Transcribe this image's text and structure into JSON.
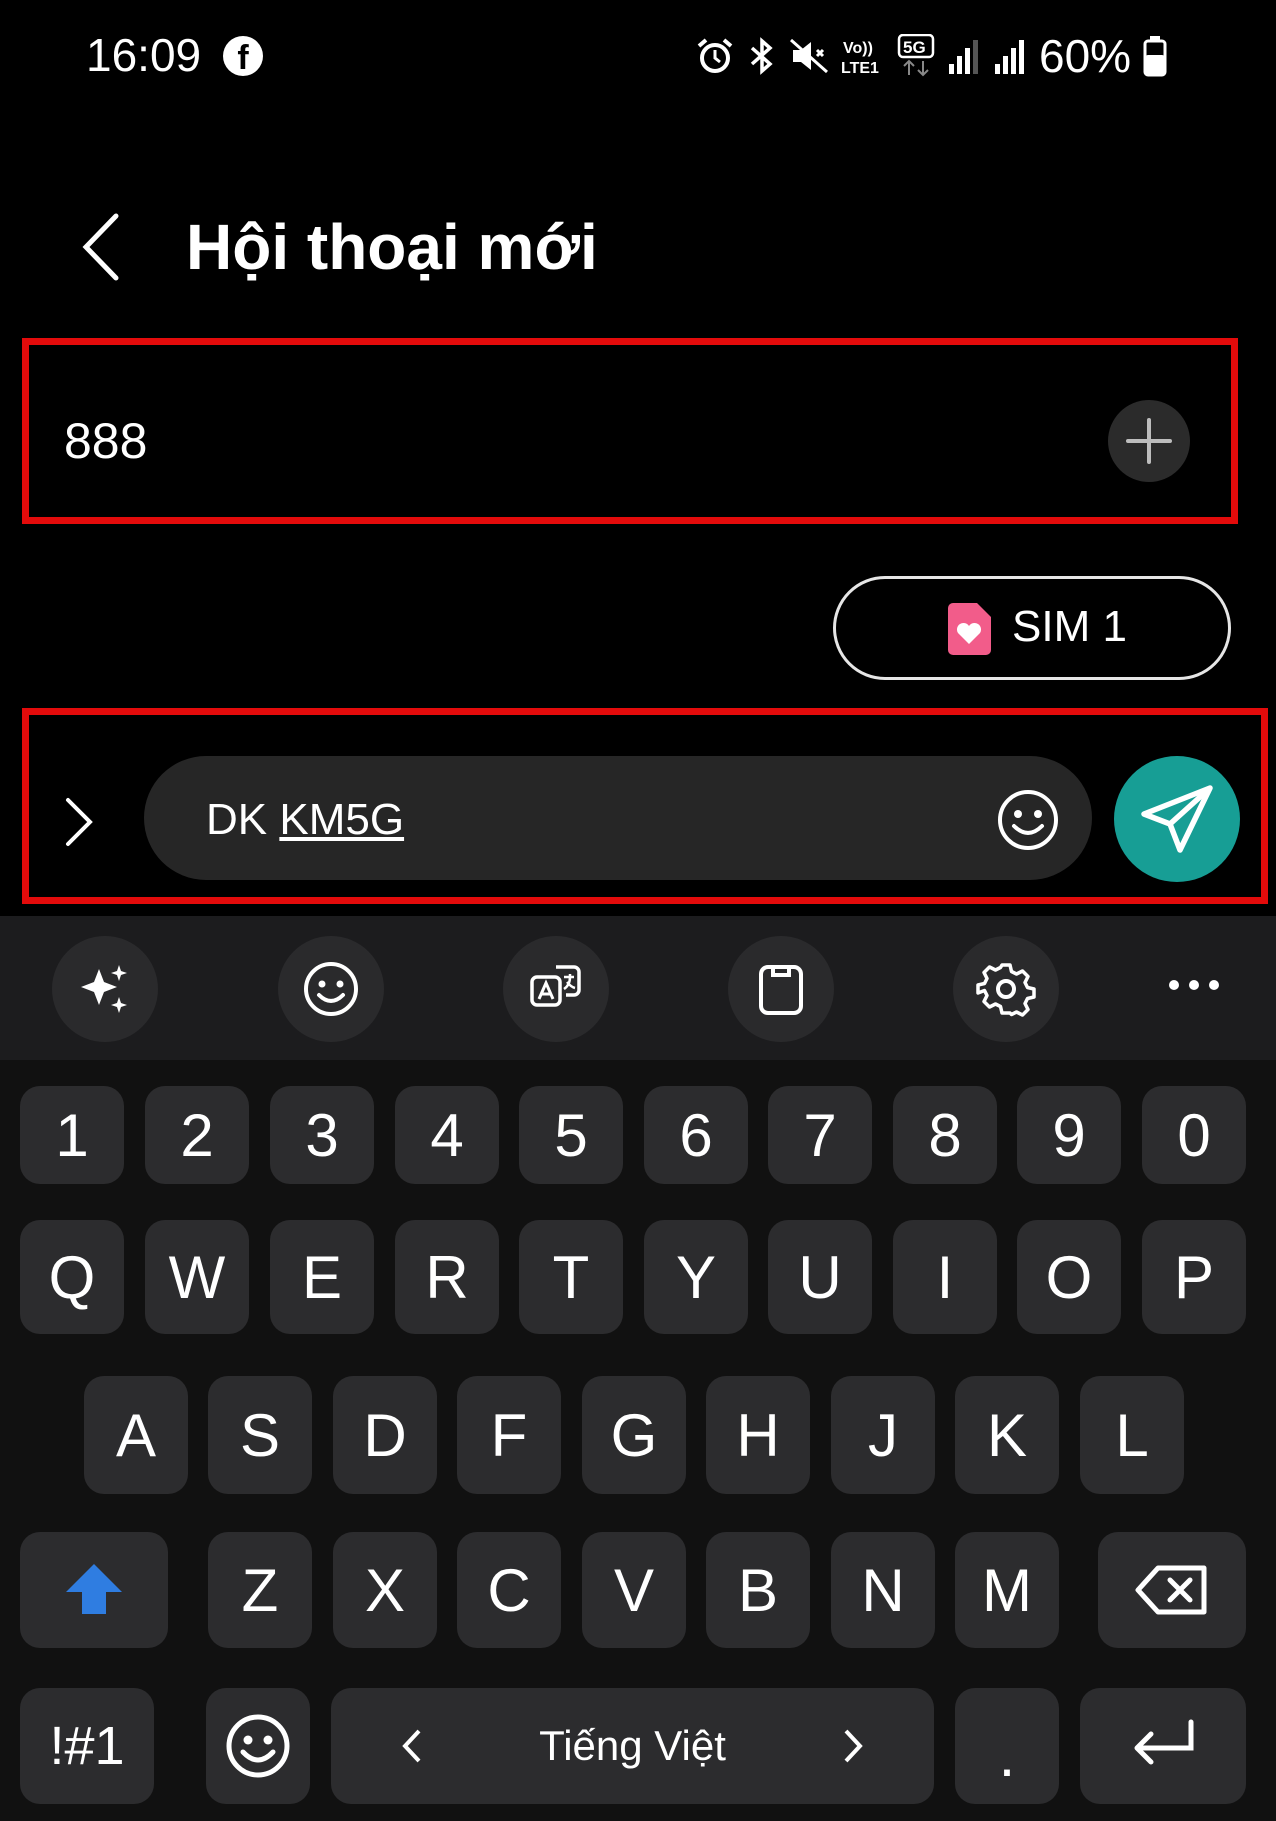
{
  "status_bar": {
    "time": "16:09",
    "battery": "60%"
  },
  "header": {
    "title": "Hội thoại mới"
  },
  "recipient": {
    "value": "888"
  },
  "sim": {
    "label": "SIM 1"
  },
  "composer": {
    "text_plain": "DK ",
    "text_underlined": "KM5G"
  },
  "keyboard": {
    "numbers": [
      "1",
      "2",
      "3",
      "4",
      "5",
      "6",
      "7",
      "8",
      "9",
      "0"
    ],
    "row1": [
      "Q",
      "W",
      "E",
      "R",
      "T",
      "Y",
      "U",
      "I",
      "O",
      "P"
    ],
    "row2": [
      "A",
      "S",
      "D",
      "F",
      "G",
      "H",
      "J",
      "K",
      "L"
    ],
    "row3": [
      "Z",
      "X",
      "C",
      "V",
      "B",
      "N",
      "M"
    ],
    "symbols_label": "!#1",
    "language_label": "Tiếng Việt",
    "period_label": "."
  },
  "colors": {
    "highlight": "#e30b0b",
    "send": "#179e95",
    "shift": "#2f7de1"
  }
}
